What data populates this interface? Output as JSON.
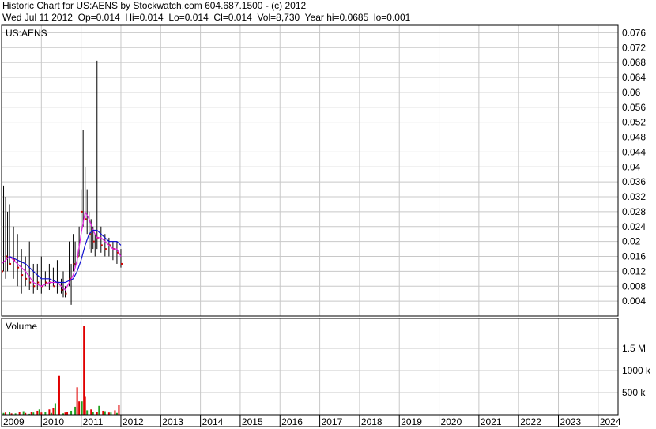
{
  "header": {
    "title": "Historic Chart for US:AENS by Stockwatch.com 604.687.1500 - (c) 2012",
    "stats": "Wed Jul 11 2012  Op=0.014  Hi=0.014  Lo=0.014  Cl=0.014  Vol=8,730  Year hi=0.0685  lo=0.001"
  },
  "chart_data": [
    {
      "type": "line",
      "name": "price-panel",
      "title": "US:AENS",
      "ylim": [
        0.0,
        0.078
      ],
      "y_ticks": [
        "0.076",
        "0.072",
        "0.068",
        "0.064",
        "0.06",
        "0.056",
        "0.052",
        "0.048",
        "0.044",
        "0.04",
        "0.036",
        "0.032",
        "0.028",
        "0.024",
        "0.02",
        "0.016",
        "0.012",
        "0.008",
        "0.004"
      ],
      "x_ticks": [
        "2009",
        "2010",
        "2011",
        "2012",
        "2013",
        "2014",
        "2015",
        "2016",
        "2017",
        "2018",
        "2019",
        "2020",
        "2021",
        "2022",
        "2023",
        "2024"
      ],
      "xlim": [
        2009.0,
        2024.5
      ],
      "grid": true,
      "series": [
        {
          "type": "hilo",
          "color": "#000000",
          "x": [
            2009.0,
            2009.05,
            2009.1,
            2009.15,
            2009.2,
            2009.3,
            2009.4,
            2009.5,
            2009.6,
            2009.7,
            2009.8,
            2009.9,
            2010.0,
            2010.1,
            2010.2,
            2010.3,
            2010.4,
            2010.5,
            2010.55,
            2010.6,
            2010.7,
            2010.75,
            2010.8,
            2010.85,
            2010.9,
            2010.95,
            2011.0,
            2011.05,
            2011.1,
            2011.15,
            2011.2,
            2011.25,
            2011.3,
            2011.35,
            2011.4,
            2011.5,
            2011.6,
            2011.7,
            2011.8,
            2011.9,
            2012.0
          ],
          "high": [
            0.028,
            0.035,
            0.032,
            0.028,
            0.03,
            0.024,
            0.022,
            0.018,
            0.016,
            0.02,
            0.014,
            0.014,
            0.016,
            0.012,
            0.014,
            0.013,
            0.015,
            0.01,
            0.012,
            0.008,
            0.02,
            0.014,
            0.022,
            0.02,
            0.018,
            0.024,
            0.034,
            0.05,
            0.04,
            0.034,
            0.028,
            0.026,
            0.024,
            0.022,
            0.0685,
            0.024,
            0.022,
            0.021,
            0.02,
            0.02,
            0.018
          ],
          "low": [
            0.002,
            0.012,
            0.01,
            0.012,
            0.014,
            0.01,
            0.008,
            0.006,
            0.008,
            0.007,
            0.006,
            0.007,
            0.006,
            0.008,
            0.007,
            0.008,
            0.006,
            0.006,
            0.005,
            0.005,
            0.008,
            0.003,
            0.012,
            0.013,
            0.014,
            0.016,
            0.022,
            0.024,
            0.026,
            0.022,
            0.018,
            0.017,
            0.018,
            0.016,
            0.018,
            0.017,
            0.016,
            0.016,
            0.015,
            0.014,
            0.013
          ]
        },
        {
          "name": "closes",
          "type": "scatter",
          "color": "#d00000",
          "x": [
            2009.02,
            2009.12,
            2009.22,
            2009.32,
            2009.42,
            2009.52,
            2009.62,
            2009.72,
            2009.82,
            2009.92,
            2010.02,
            2010.12,
            2010.22,
            2010.32,
            2010.42,
            2010.52,
            2010.62,
            2010.72,
            2010.82,
            2010.92,
            2011.02,
            2011.12,
            2011.22,
            2011.32,
            2011.42,
            2011.52,
            2011.62,
            2011.72,
            2011.82,
            2011.92,
            2012.02
          ],
          "values": [
            0.012,
            0.016,
            0.014,
            0.015,
            0.013,
            0.011,
            0.01,
            0.009,
            0.008,
            0.009,
            0.008,
            0.009,
            0.009,
            0.008,
            0.009,
            0.007,
            0.006,
            0.01,
            0.014,
            0.016,
            0.028,
            0.026,
            0.022,
            0.02,
            0.021,
            0.019,
            0.018,
            0.019,
            0.018,
            0.017,
            0.014
          ]
        },
        {
          "name": "ma-short",
          "type": "line",
          "color": "#e020e0",
          "x": [
            2009.0,
            2009.2,
            2009.4,
            2009.6,
            2009.8,
            2010.0,
            2010.2,
            2010.4,
            2010.6,
            2010.8,
            2010.9,
            2011.0,
            2011.1,
            2011.2,
            2011.3,
            2011.4,
            2011.5,
            2011.6,
            2011.7,
            2011.8,
            2011.9,
            2012.0
          ],
          "values": [
            0.014,
            0.016,
            0.014,
            0.012,
            0.009,
            0.008,
            0.009,
            0.009,
            0.007,
            0.011,
            0.015,
            0.022,
            0.028,
            0.026,
            0.023,
            0.021,
            0.021,
            0.02,
            0.019,
            0.018,
            0.018,
            0.016
          ]
        },
        {
          "name": "ma-long",
          "type": "line",
          "color": "#1010d0",
          "x": [
            2009.2,
            2009.4,
            2009.6,
            2009.8,
            2010.0,
            2010.2,
            2010.4,
            2010.6,
            2010.8,
            2010.9,
            2011.0,
            2011.1,
            2011.2,
            2011.3,
            2011.4,
            2011.5,
            2011.6,
            2011.7,
            2011.8,
            2011.9,
            2012.0
          ],
          "values": [
            0.016,
            0.015,
            0.014,
            0.012,
            0.01,
            0.01,
            0.009,
            0.009,
            0.01,
            0.012,
            0.015,
            0.019,
            0.022,
            0.023,
            0.023,
            0.022,
            0.021,
            0.02,
            0.02,
            0.02,
            0.019
          ]
        }
      ]
    },
    {
      "type": "bar",
      "name": "volume-panel",
      "title": "Volume",
      "ylim": [
        0,
        2000000
      ],
      "y_ticks": [
        "1.5 M",
        "1000 k",
        "500 k"
      ],
      "y_tick_values": [
        1500000,
        1000000,
        500000
      ],
      "xlim": [
        2009.0,
        2024.5
      ],
      "series": [
        {
          "name": "up-volume",
          "color": "#20a020",
          "x": [
            2009.05,
            2009.2,
            2009.35,
            2009.55,
            2009.7,
            2009.8,
            2009.95,
            2010.1,
            2010.25,
            2010.35,
            2010.55,
            2010.75,
            2010.85,
            2011.02,
            2011.15,
            2011.3,
            2011.45,
            2011.6,
            2011.75,
            2011.9
          ],
          "values": [
            40000,
            60000,
            30000,
            80000,
            20000,
            50000,
            120000,
            60000,
            40000,
            260000,
            30000,
            90000,
            180000,
            300000,
            100000,
            60000,
            200000,
            80000,
            50000,
            40000
          ]
        },
        {
          "name": "down-volume",
          "color": "#e00000",
          "x": [
            2009.1,
            2009.25,
            2009.45,
            2009.6,
            2009.75,
            2009.9,
            2010.0,
            2010.2,
            2010.3,
            2010.45,
            2010.6,
            2010.65,
            2010.9,
            2010.95,
            2011.07,
            2011.1,
            2011.25,
            2011.4,
            2011.55,
            2011.7,
            2011.85,
            2011.95
          ],
          "values": [
            50000,
            30000,
            70000,
            40000,
            60000,
            90000,
            50000,
            120000,
            160000,
            880000,
            50000,
            70000,
            620000,
            300000,
            2000000,
            420000,
            120000,
            60000,
            90000,
            50000,
            100000,
            220000
          ]
        }
      ]
    }
  ]
}
